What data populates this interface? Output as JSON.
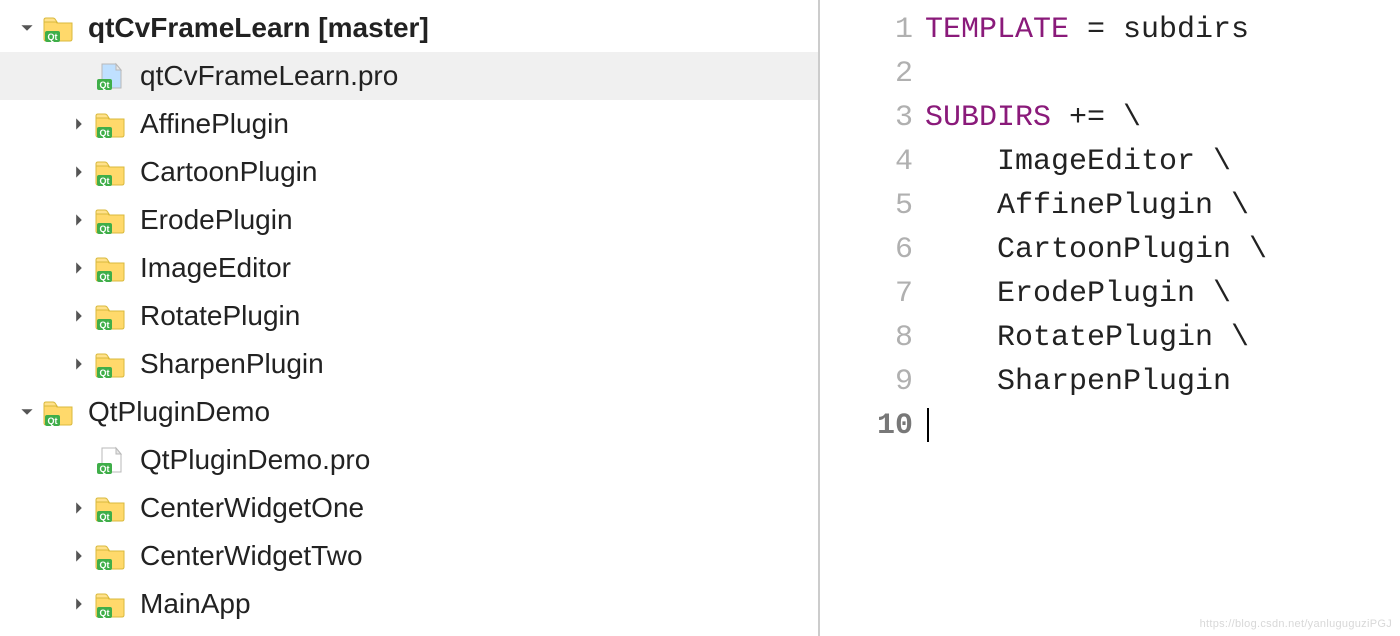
{
  "tree": [
    {
      "indent": 0,
      "arrow": "down",
      "icon": "folder-qt",
      "label": "qtCvFrameLearn [master]",
      "bold": true,
      "selected": false
    },
    {
      "indent": 1,
      "arrow": "none",
      "icon": "file-qt",
      "label": "qtCvFrameLearn.pro",
      "bold": false,
      "selected": true
    },
    {
      "indent": 1,
      "arrow": "right",
      "icon": "folder-qt",
      "label": "AffinePlugin",
      "bold": false,
      "selected": false
    },
    {
      "indent": 1,
      "arrow": "right",
      "icon": "folder-qt",
      "label": "CartoonPlugin",
      "bold": false,
      "selected": false
    },
    {
      "indent": 1,
      "arrow": "right",
      "icon": "folder-qt",
      "label": "ErodePlugin",
      "bold": false,
      "selected": false
    },
    {
      "indent": 1,
      "arrow": "right",
      "icon": "folder-qt",
      "label": "ImageEditor",
      "bold": false,
      "selected": false
    },
    {
      "indent": 1,
      "arrow": "right",
      "icon": "folder-qt",
      "label": "RotatePlugin",
      "bold": false,
      "selected": false
    },
    {
      "indent": 1,
      "arrow": "right",
      "icon": "folder-qt",
      "label": "SharpenPlugin",
      "bold": false,
      "selected": false
    },
    {
      "indent": 0,
      "arrow": "down",
      "icon": "folder-qt",
      "label": "QtPluginDemo",
      "bold": false,
      "selected": false
    },
    {
      "indent": 1,
      "arrow": "none",
      "icon": "file-qt",
      "label": "QtPluginDemo.pro",
      "bold": false,
      "selected": false
    },
    {
      "indent": 1,
      "arrow": "right",
      "icon": "folder-qt",
      "label": "CenterWidgetOne",
      "bold": false,
      "selected": false
    },
    {
      "indent": 1,
      "arrow": "right",
      "icon": "folder-qt",
      "label": "CenterWidgetTwo",
      "bold": false,
      "selected": false
    },
    {
      "indent": 1,
      "arrow": "right",
      "icon": "folder-qt",
      "label": "MainApp",
      "bold": false,
      "selected": false
    }
  ],
  "code": {
    "lines": [
      {
        "n": 1,
        "tokens": [
          {
            "t": "TEMPLATE",
            "c": "kw"
          },
          {
            "t": " = subdirs",
            "c": ""
          }
        ]
      },
      {
        "n": 2,
        "tokens": []
      },
      {
        "n": 3,
        "tokens": [
          {
            "t": "SUBDIRS",
            "c": "kw"
          },
          {
            "t": " += \\",
            "c": ""
          }
        ]
      },
      {
        "n": 4,
        "tokens": [
          {
            "t": "    ImageEditor \\",
            "c": ""
          }
        ]
      },
      {
        "n": 5,
        "tokens": [
          {
            "t": "    AffinePlugin \\",
            "c": ""
          }
        ]
      },
      {
        "n": 6,
        "tokens": [
          {
            "t": "    CartoonPlugin \\",
            "c": ""
          }
        ]
      },
      {
        "n": 7,
        "tokens": [
          {
            "t": "    ErodePlugin \\",
            "c": ""
          }
        ]
      },
      {
        "n": 8,
        "tokens": [
          {
            "t": "    RotatePlugin \\",
            "c": ""
          }
        ]
      },
      {
        "n": 9,
        "tokens": [
          {
            "t": "    SharpenPlugin",
            "c": ""
          }
        ]
      },
      {
        "n": 10,
        "tokens": [],
        "cursor": true
      }
    ],
    "current_line": 10
  },
  "watermark": "https://blog.csdn.net/yanluguguziPGJ"
}
